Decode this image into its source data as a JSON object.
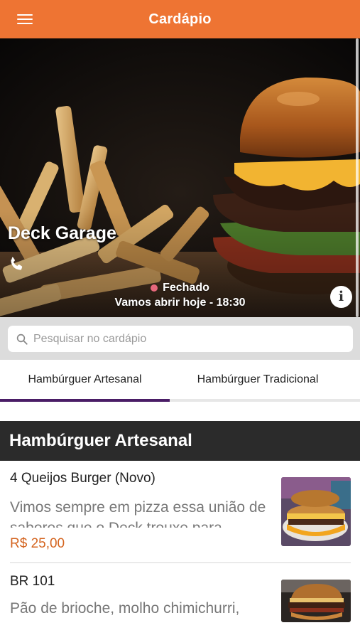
{
  "header": {
    "title": "Cardápio",
    "menu_icon": "hamburger-menu-icon"
  },
  "hero": {
    "store_name": "Deck Garage",
    "phone_icon": "phone-icon",
    "status_label": "Fechado",
    "status_color": "#e6687c",
    "opening_text": "Vamos abrir hoje - 18:30",
    "info_label": "i"
  },
  "search": {
    "placeholder": "Pesquisar no cardápio",
    "value": ""
  },
  "tabs": [
    {
      "label": "Hambúrguer Artesanal",
      "active": true
    },
    {
      "label": "Hambúrguer Tradicional",
      "active": false
    }
  ],
  "section": {
    "title": "Hambúrguer Artesanal"
  },
  "items": [
    {
      "name": "4 Queijos Burger (Novo)",
      "description": "Vimos sempre em pizza essa união de sabores que o Deck trouxe para",
      "price": "R$ 25,00"
    },
    {
      "name": "BR 101",
      "description": "Pão de brioche, molho chimichurri,",
      "price": ""
    }
  ],
  "colors": {
    "brand": "#ee7433",
    "tab_indicator": "#4a1d66",
    "price": "#d4641f",
    "section_header": "#2b2b2b"
  }
}
